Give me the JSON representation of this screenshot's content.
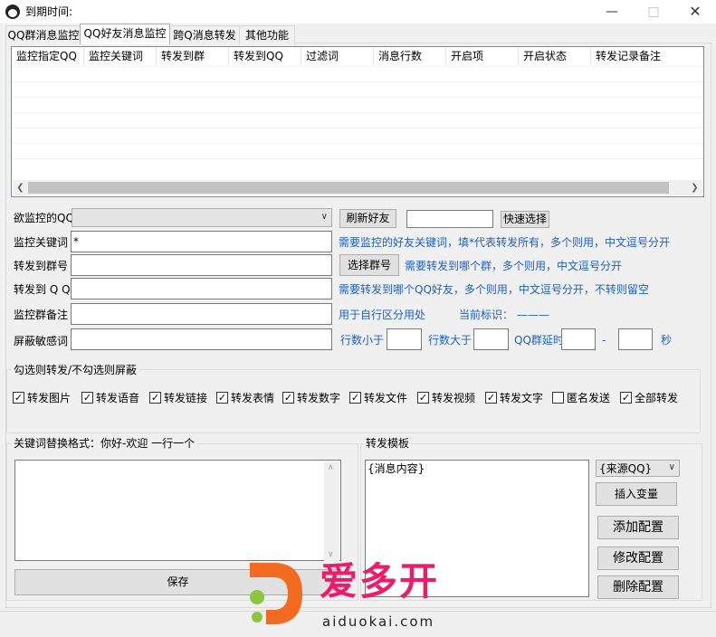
{
  "window": {
    "title": "到期时间:"
  },
  "tabs": [
    {
      "label": "QQ群消息监控"
    },
    {
      "label": "QQ好友消息监控"
    },
    {
      "label": "跨Q消息转发"
    },
    {
      "label": "其他功能"
    }
  ],
  "table": {
    "columns": [
      "监控指定QQ",
      "监控关键词",
      "转发到群",
      "转发到QQ",
      "过滤词",
      "消息行数",
      "开启项",
      "开启状态",
      "转发记录备注"
    ]
  },
  "form": {
    "watch_qq_label": "欲监控的QQ",
    "watch_qq_value": "",
    "refresh_friends_button": "刷新好友",
    "quick_search_value": "",
    "quick_select_button": "快速选择",
    "keyword_label": "监控关键词",
    "keyword_value": "*",
    "keyword_hint": "需要监控的好友关键词，填*代表转发所有，多个则用，中文逗号分开",
    "forward_group_label": "转发到群号",
    "forward_group_value": "",
    "select_group_button": "选择群号",
    "forward_group_hint": "需要转发到哪个群，多个则用，中文逗号分开",
    "forward_qq_label": "转发到 Q Q",
    "forward_qq_value": "",
    "forward_qq_hint": "需要转发到哪个QQ好友，多个则用，中文逗号分开，不转则留空",
    "group_note_label": "监控群备注",
    "group_note_value": "",
    "group_note_hint": "用于自行区分用处",
    "current_mark_label": "当前标识：",
    "current_mark_value": "———",
    "block_words_label": "屏蔽敏感词",
    "block_words_value": "",
    "lines_less_label": "行数小于",
    "lines_less_value": "",
    "lines_greater_label": "行数大于",
    "lines_greater_value": "",
    "group_delay_label": "QQ群延时",
    "group_delay_from": "",
    "dash": "-",
    "group_delay_to": "",
    "seconds_label": "秒"
  },
  "options": {
    "title": "勾选则转发/不勾选则屏蔽",
    "items": [
      {
        "label": "转发图片",
        "mark": "✓"
      },
      {
        "label": "转发语音",
        "mark": "✓"
      },
      {
        "label": "转发链接",
        "mark": "✓"
      },
      {
        "label": "转发表情",
        "mark": "✓"
      },
      {
        "label": "转发数字",
        "mark": "✓"
      },
      {
        "label": "转发文件",
        "mark": "✓"
      },
      {
        "label": "转发视频",
        "mark": "✓"
      },
      {
        "label": "转发文字",
        "mark": "✓"
      },
      {
        "label": "匿名发送",
        "mark": ""
      },
      {
        "label": "全部转发",
        "mark": "✓"
      }
    ]
  },
  "replace": {
    "title": "关键词替换格式：你好-欢迎 一行一个",
    "value": "",
    "save_button": "保存"
  },
  "template": {
    "title": "转发模板",
    "value": "{消息内容}",
    "source_select": "{来源QQ}",
    "insert_var_button": "插入变量",
    "add_config_button": "添加配置",
    "edit_config_button": "修改配置",
    "delete_config_button": "删除配置"
  },
  "watermark": {
    "brand": "爱多开",
    "domain": "aiduokai.com"
  }
}
